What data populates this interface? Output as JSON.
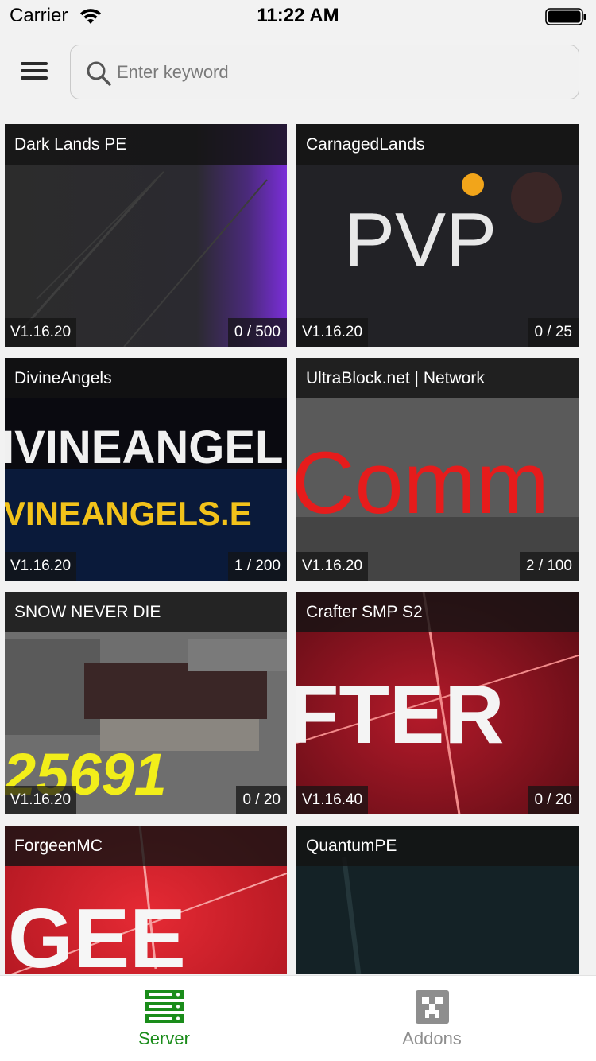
{
  "status_bar": {
    "carrier": "Carrier",
    "time": "11:22 AM"
  },
  "search": {
    "placeholder": "Enter keyword",
    "value": ""
  },
  "colors": {
    "active_tab": "#1a8c1a",
    "inactive_tab": "#8e8e8e",
    "card_overlay": "#141414"
  },
  "servers": [
    {
      "name": "Dark Lands PE",
      "version": "V1.16.20",
      "players": "0 / 500"
    },
    {
      "name": "CarnagedLands",
      "version": "V1.16.20",
      "players": "0 / 25"
    },
    {
      "name": "DivineAngels",
      "version": "V1.16.20",
      "players": "1 / 200"
    },
    {
      "name": "UltraBlock.net | Network",
      "version": "V1.16.20",
      "players": "2 / 100"
    },
    {
      "name": "SNOW NEVER DIE",
      "version": "V1.16.20",
      "players": "0 / 20"
    },
    {
      "name": "Crafter SMP S2",
      "version": "V1.16.40",
      "players": "0 / 20"
    },
    {
      "name": "ForgeenMC"
    },
    {
      "name": "QuantumPE"
    }
  ],
  "thumb_text": {
    "pvp": "PVP",
    "divine_1": "IVINEANGEL",
    "divine_2": "VINEANGELS.E",
    "comm": "Comm",
    "snow": "25691",
    "crafter": "FTER",
    "forgeen": "GEE"
  },
  "tabs": [
    {
      "label": "Server",
      "icon": "server-icon",
      "active": true
    },
    {
      "label": "Addons",
      "icon": "addons-icon",
      "active": false
    }
  ]
}
